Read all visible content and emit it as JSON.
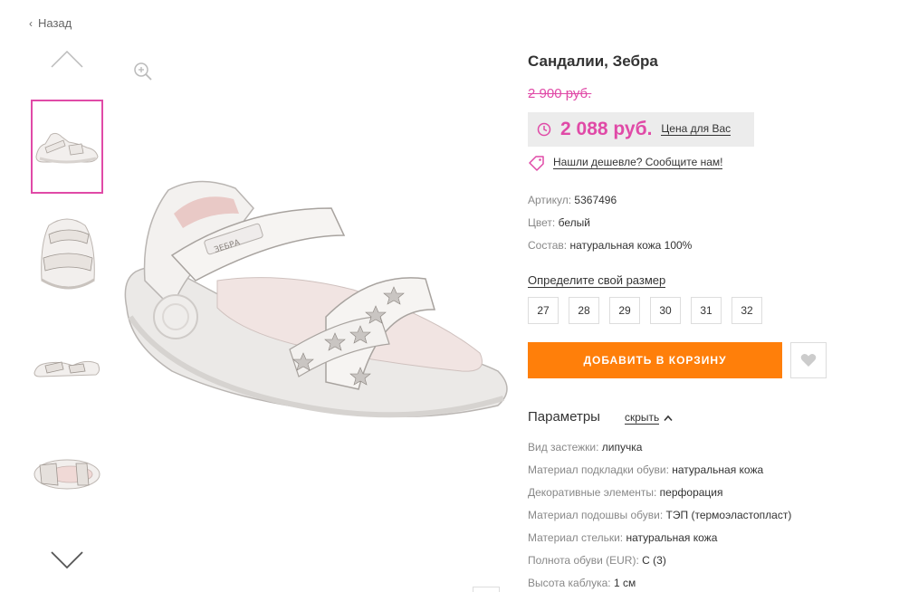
{
  "nav": {
    "back_label": "Назад"
  },
  "product": {
    "title": "Сандалии, Зебра",
    "old_price": "2 900 руб.",
    "price": "2 088 руб.",
    "price_label": "Цена для Вас",
    "cheaper_link": "Нашли дешевле? Сообщите нам!",
    "attributes": [
      {
        "key": "Артикул:",
        "value": "5367496"
      },
      {
        "key": "Цвет:",
        "value": "белый"
      },
      {
        "key": "Состав:",
        "value": "натуральная кожа 100%"
      }
    ],
    "size_label": "Определите свой размер",
    "sizes": [
      "27",
      "28",
      "29",
      "30",
      "31",
      "32"
    ],
    "cart_button": "ДОБАВИТЬ В КОРЗИНУ",
    "params_title": "Параметры",
    "params_toggle": "скрыть",
    "params": [
      {
        "key": "Вид застежки:",
        "value": "липучка"
      },
      {
        "key": "Материал подкладки обуви:",
        "value": "натуральная кожа"
      },
      {
        "key": "Декоративные элементы:",
        "value": "перфорация"
      },
      {
        "key": "Материал подошвы обуви:",
        "value": "ТЭП (термоэластопласт)"
      },
      {
        "key": "Материал стельки:",
        "value": "натуральная кожа"
      },
      {
        "key": "Полнота обуви (EUR):",
        "value": "C (3)"
      },
      {
        "key": "Высота каблука:",
        "value": "1 см"
      }
    ],
    "brand_logo": "ЗЕБРА"
  },
  "colors": {
    "accent": "#e04aa7",
    "button": "#ff7f0a",
    "price_bg": "#ececec"
  },
  "icons": [
    "chevron-left-icon",
    "chevron-up-icon",
    "chevron-down-icon",
    "zoom-in-icon",
    "clock-icon",
    "price-tag-icon",
    "heart-icon",
    "chevron-up-small-icon"
  ]
}
